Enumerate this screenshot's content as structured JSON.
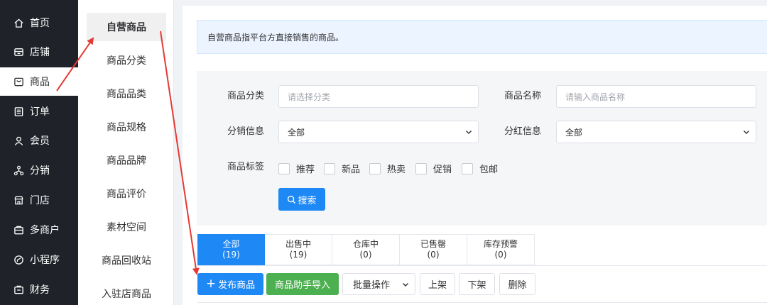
{
  "nav1": {
    "items": [
      {
        "label": "首页",
        "icon": "home-icon"
      },
      {
        "label": "店铺",
        "icon": "shop-icon"
      },
      {
        "label": "商品",
        "icon": "goods-icon"
      },
      {
        "label": "订单",
        "icon": "order-icon"
      },
      {
        "label": "会员",
        "icon": "user-icon"
      },
      {
        "label": "分销",
        "icon": "distribution-icon"
      },
      {
        "label": "门店",
        "icon": "store-icon"
      },
      {
        "label": "多商户",
        "icon": "merchant-icon"
      },
      {
        "label": "小程序",
        "icon": "miniprogram-icon"
      },
      {
        "label": "财务",
        "icon": "finance-icon"
      }
    ]
  },
  "nav2": {
    "items": [
      {
        "label": "自营商品"
      },
      {
        "label": "商品分类"
      },
      {
        "label": "商品品类"
      },
      {
        "label": "商品规格"
      },
      {
        "label": "商品品牌"
      },
      {
        "label": "商品评价"
      },
      {
        "label": "素材空间"
      },
      {
        "label": "商品回收站"
      },
      {
        "label": "入驻店商品"
      }
    ]
  },
  "notice": {
    "text": "自营商品指平台方直接销售的商品。"
  },
  "filter": {
    "category_label": "商品分类",
    "category_placeholder": "请选择分类",
    "name_label": "商品名称",
    "name_placeholder": "请输入商品名称",
    "distribution_label": "分销信息",
    "distribution_value": "全部",
    "dividend_label": "分红信息",
    "dividend_value": "全部",
    "tags_label": "商品标签",
    "tags": [
      "推荐",
      "新品",
      "热卖",
      "促销",
      "包邮"
    ],
    "search_label": "搜索"
  },
  "tabs": [
    {
      "label": "全部",
      "count": "(19)"
    },
    {
      "label": "出售中",
      "count": "(19)"
    },
    {
      "label": "仓库中",
      "count": "(0)"
    },
    {
      "label": "已售罄",
      "count": "(0)"
    },
    {
      "label": "库存预警",
      "count": "(0)"
    }
  ],
  "actions": {
    "publish": "发布商品",
    "import": "商品助手导入",
    "batch": "批量操作",
    "on_shelf": "上架",
    "off_shelf": "下架",
    "delete": "删除"
  },
  "colors": {
    "sidebar_bg": "#1f2329",
    "primary": "#1e88f5",
    "success": "#4caf50",
    "annotation": "#e53935"
  }
}
